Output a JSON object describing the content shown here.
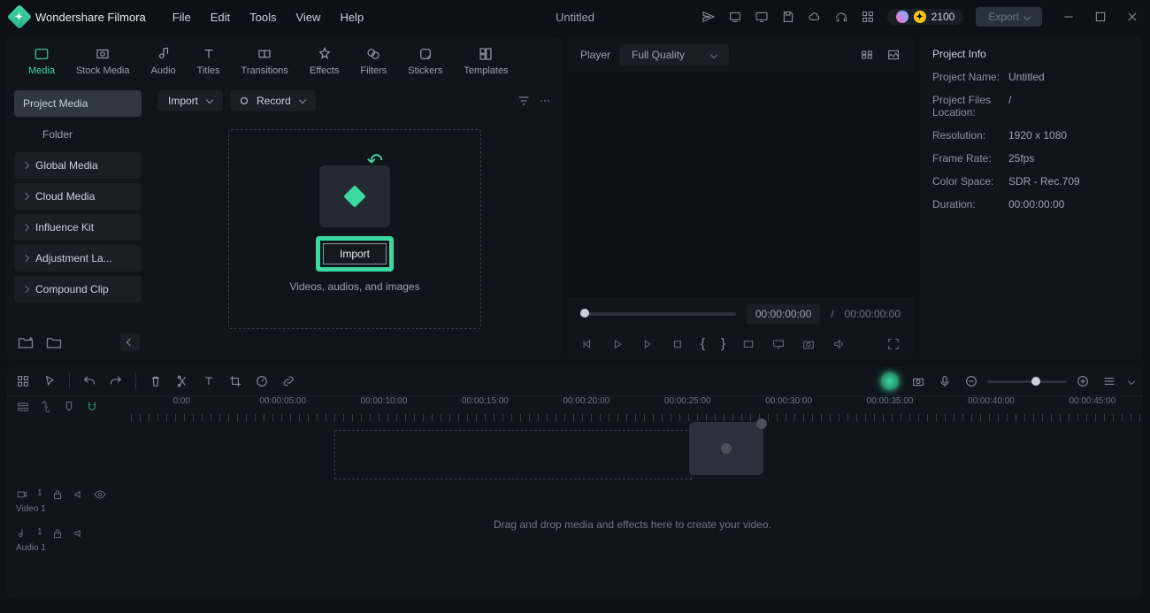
{
  "app": {
    "name": "Wondershare Filmora",
    "document": "Untitled"
  },
  "menu": [
    "File",
    "Edit",
    "Tools",
    "View",
    "Help"
  ],
  "titlebar": {
    "coins": "2100",
    "export": "Export"
  },
  "tabs": [
    {
      "label": "Media",
      "active": true
    },
    {
      "label": "Stock Media"
    },
    {
      "label": "Audio"
    },
    {
      "label": "Titles"
    },
    {
      "label": "Transitions"
    },
    {
      "label": "Effects"
    },
    {
      "label": "Filters"
    },
    {
      "label": "Stickers"
    },
    {
      "label": "Templates"
    }
  ],
  "sidebar": {
    "items": [
      {
        "label": "Project Media",
        "selected": true
      },
      {
        "label": "Folder",
        "folder": true
      },
      {
        "label": "Global Media"
      },
      {
        "label": "Cloud Media"
      },
      {
        "label": "Influence Kit"
      },
      {
        "label": "Adjustment La..."
      },
      {
        "label": "Compound Clip"
      }
    ]
  },
  "mediaToolbar": {
    "import": "Import",
    "record": "Record"
  },
  "dropzone": {
    "button": "Import",
    "hint": "Videos, audios, and images"
  },
  "player": {
    "label": "Player",
    "quality": "Full Quality",
    "timecode": "00:00:00:00",
    "sep": "/",
    "duration": "00:00:00:00"
  },
  "project": {
    "title": "Project Info",
    "rows": [
      {
        "label": "Project Name:",
        "value": "Untitled"
      },
      {
        "label": "Project Files Location:",
        "value": "/"
      },
      {
        "label": "Resolution:",
        "value": "1920 x 1080"
      },
      {
        "label": "Frame Rate:",
        "value": "25fps"
      },
      {
        "label": "Color Space:",
        "value": "SDR - Rec.709"
      },
      {
        "label": "Duration:",
        "value": "00:00:00:00"
      }
    ]
  },
  "timeline": {
    "ruler": [
      "0:00",
      "00:00:05:00",
      "00:00:10:00",
      "00:00:15:00",
      "00:00:20:00",
      "00:00:25:00",
      "00:00:30:00",
      "00:00:35:00",
      "00:00:40:00",
      "00:00:45:00"
    ],
    "tracks": {
      "video": "Video 1",
      "audio": "Audio 1"
    },
    "hint": "Drag and drop media and effects here to create your video."
  }
}
